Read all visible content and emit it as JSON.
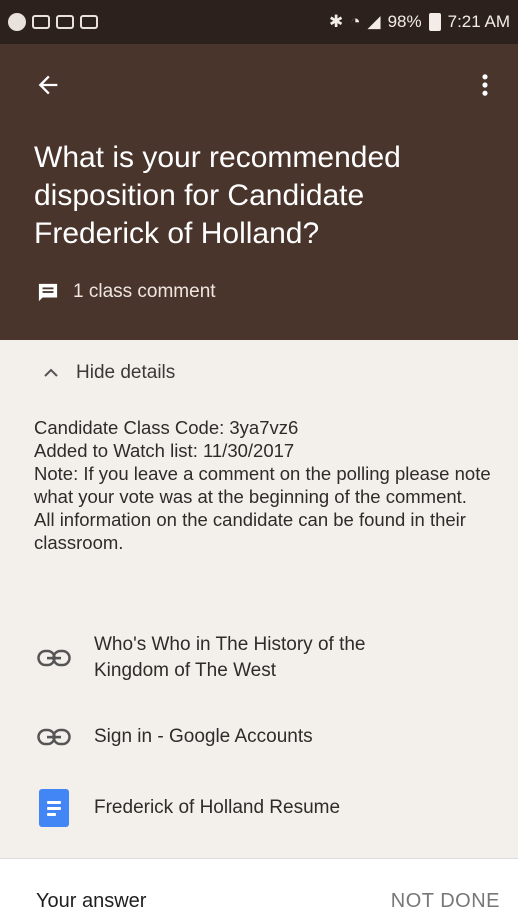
{
  "status_bar": {
    "signal": "98%",
    "time": "7:21 AM"
  },
  "question": {
    "title": "What is your recommended disposition for Candidate Frederick of Holland?",
    "comments": "1 class comment"
  },
  "details": {
    "toggle_label": "Hide details",
    "lines": [
      "Candidate Class Code: 3ya7vz6",
      "Added to Watch list: 11/30/2017",
      "Note: If you leave a comment on the polling please note what your vote was at the beginning of the comment.",
      "All information on the candidate can be found in their classroom."
    ]
  },
  "materials": [
    {
      "label": "Who's Who in The History of the Kingdom of The West",
      "icon": "link-icon"
    },
    {
      "label": "Sign in - Google Accounts",
      "icon": "link-icon"
    },
    {
      "label": "Frederick of Holland Resume",
      "icon": "google-doc-icon"
    }
  ],
  "answer": {
    "label": "Your answer",
    "status": "NOT DONE"
  },
  "colors": {
    "header": "#4a352d",
    "status_bar": "#2c211d",
    "body": "#f3f0ec",
    "doc_blue": "#4285f4"
  }
}
